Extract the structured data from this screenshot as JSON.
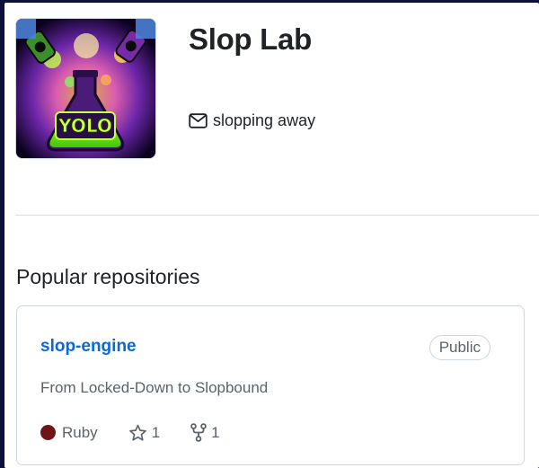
{
  "profile": {
    "name": "Slop Lab",
    "email": "slopping away",
    "avatar_text": "YOLO"
  },
  "popular": {
    "title": "Popular repositories",
    "repos": [
      {
        "name": "slop-engine",
        "visibility": "Public",
        "description": "From Locked-Down to Slopbound",
        "language": "Ruby",
        "language_color": "#701516",
        "stars": "1",
        "forks": "1"
      }
    ]
  },
  "colors": {
    "link": "#0969da",
    "muted": "#59636e",
    "border": "#d0d7de",
    "frame": "#0d1038"
  },
  "icons": {
    "email": "mail-icon",
    "star": "star-icon",
    "fork": "repo-forked-icon"
  }
}
